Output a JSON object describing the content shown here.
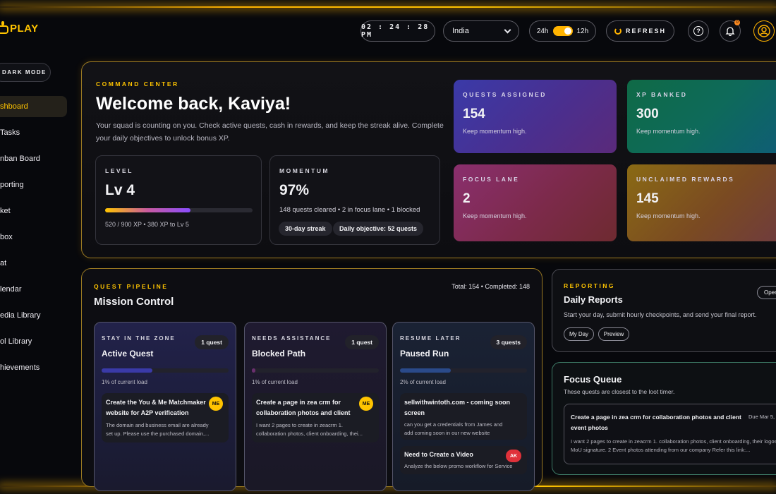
{
  "brand": {
    "name": "PLAY"
  },
  "topbar": {
    "clock": "02 : 24 : 28  PM",
    "country": "India",
    "format_24": "24h",
    "format_12": "12h",
    "refresh_label": "REFRESH",
    "help_glyph": "?",
    "notification_count": "0",
    "accent": "#ffc400"
  },
  "sidebar": {
    "dark_mode_label": "DARK MODE",
    "items": [
      {
        "label": "shboard",
        "active": true
      },
      {
        "label": "Tasks"
      },
      {
        "label": "nban Board"
      },
      {
        "label": "porting"
      },
      {
        "label": "ket"
      },
      {
        "label": "box"
      },
      {
        "label": "at"
      },
      {
        "label": "lendar"
      },
      {
        "label": "edia Library"
      },
      {
        "label": "ol Library"
      },
      {
        "label": "hievements"
      }
    ]
  },
  "command_center": {
    "eyebrow": "COMMAND CENTER",
    "title": "Welcome back, Kaviya!",
    "subtitle_line1": "Your squad is counting on you. Check active quests, cash in rewards, and keep the streak alive. Complete",
    "subtitle_line2": "your daily objectives to unlock bonus XP.",
    "level": {
      "label": "LEVEL",
      "value": "Lv 4",
      "progress": 0.578,
      "caption": "520 / 900 XP • 380 XP to Lv 5"
    },
    "momentum": {
      "label": "MOMENTUM",
      "value": "97%",
      "caption": "148 quests cleared • 2 in focus lane • 1 blocked",
      "chips": [
        "30-day streak",
        "Daily objective: 52 quests"
      ]
    },
    "tiles": [
      {
        "label": "QUESTS ASSIGNED",
        "value": "154",
        "note": "Keep momentum high."
      },
      {
        "label": "XP BANKED",
        "value": "300",
        "note": "Keep momentum high."
      },
      {
        "label": "FOCUS LANE",
        "value": "2",
        "note": "Keep momentum high."
      },
      {
        "label": "UNCLAIMED REWARDS",
        "value": "145",
        "note": "Keep momentum high."
      }
    ]
  },
  "mission": {
    "eyebrow": "QUEST PIPELINE",
    "title": "Mission Control",
    "summary": "Total: 154 • Completed: 148",
    "columns": [
      {
        "eyebrow": "STAY IN THE ZONE",
        "title": "Active Quest",
        "count": "1 quest",
        "load": "1% of current load",
        "load_fraction": 0.4,
        "cards": [
          {
            "title1": "Create the You & Me Matchmaker",
            "title2": "website for A2P verification",
            "body1": "The domain and business email are already",
            "body2": "set up. Please use the purchased domain,...",
            "tag": "ME"
          }
        ]
      },
      {
        "eyebrow": "NEEDS ASSISTANCE",
        "title": "Blocked Path",
        "count": "1 quest",
        "load": "1% of current load",
        "load_fraction": 0.03,
        "cards": [
          {
            "title1": "Create a page in zea crm for",
            "title2": "collaboration photos and client",
            "body1": "I want 2 pages to create in zeacrm 1.",
            "body2": "collaboration photos, client onboarding, thei...",
            "tag": "ME"
          }
        ]
      },
      {
        "eyebrow": "RESUME LATER",
        "title": "Paused Run",
        "count": "3 quests",
        "load": "2% of current load",
        "load_fraction": 0.4,
        "cards": [
          {
            "title1": "sellwithwintoth.com - coming soon",
            "title2": "screen",
            "body1": "can you get a credentials from James and",
            "body2": "add coming soon in our new website",
            "tag": ""
          },
          {
            "title1": "Need to Create a Video",
            "title2": "",
            "body1": "Analyze the below promo workflow for Service",
            "body2": "",
            "tag": "AK"
          }
        ]
      }
    ]
  },
  "reporting": {
    "eyebrow": "REPORTING",
    "title": "Daily Reports",
    "subtitle": "Start your day, submit hourly checkpoints, and send your final report.",
    "btn_my_day": "My Day",
    "btn_preview": "Preview",
    "btn_open": "Oper"
  },
  "focus_queue": {
    "title": "Focus Queue",
    "subtitle": "These quests are closest to the loot timer.",
    "card": {
      "title1": "Create a page in zea crm for collaboration photos and client",
      "title2": "event photos",
      "due": "Due Mar 5,",
      "body1": "I want 2 pages to create in zeacrm 1. collaboration photos, client onboarding, their logos",
      "body2": "MoU signature. 2 Event photos attending from our company Refer this link:..."
    }
  }
}
